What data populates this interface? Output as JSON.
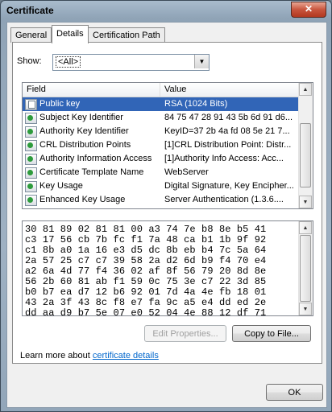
{
  "window": {
    "title": "Certificate",
    "close_glyph": "✕"
  },
  "tabs": [
    "General",
    "Details",
    "Certification Path"
  ],
  "active_tab": "Details",
  "show": {
    "label": "Show:",
    "value": "<All>"
  },
  "fields": {
    "headers": {
      "field": "Field",
      "value": "Value"
    },
    "rows": [
      {
        "field": "Public key",
        "value": "RSA (1024 Bits)",
        "icon": "certificate-field-icon",
        "selected": true
      },
      {
        "field": "Subject Key Identifier",
        "value": "84 75 47 28 91 43 5b 6d 91 d6...",
        "icon": "extension-icon"
      },
      {
        "field": "Authority Key Identifier",
        "value": "KeyID=37 2b 4a fd 08 5e 21 7...",
        "icon": "extension-icon"
      },
      {
        "field": "CRL Distribution Points",
        "value": "[1]CRL Distribution Point: Distr...",
        "icon": "extension-icon"
      },
      {
        "field": "Authority Information Access",
        "value": "[1]Authority Info Access: Acc...",
        "icon": "extension-icon"
      },
      {
        "field": "Certificate Template Name",
        "value": "WebServer",
        "icon": "extension-icon"
      },
      {
        "field": "Key Usage",
        "value": "Digital Signature, Key Encipher...",
        "icon": "extension-icon"
      },
      {
        "field": "Enhanced Key Usage",
        "value": "Server Authentication (1.3.6....",
        "icon": "extension-icon"
      }
    ]
  },
  "hex_lines": [
    "30 81 89 02 81 81 00 a3 74 7e b8 8e b5 41",
    "c3 17 56 cb 7b fc f1 7a 48 ca b1 1b 9f 92",
    "c1 8b a0 1a 16 e3 d5 dc 8b eb b4 7c 5a 64",
    "2a 57 25 c7 c7 39 58 2a d2 6d b9 f4 70 e4",
    "a2 6a 4d 77 f4 36 02 af 8f 56 79 20 8d 8e",
    "56 2b 60 81 ab f1 59 0c 75 3e c7 22 3d 85",
    "b0 b7 ea d7 12 b6 92 01 7d 4a 4e fb 18 01",
    "43 2a 3f 43 8c f8 e7 fa 9c a5 e4 dd ed 2e",
    "dd aa d9 b7 5e 07 e0 52 04 4e 88 12 df 71"
  ],
  "buttons": {
    "edit_properties": "Edit Properties...",
    "copy_to_file": "Copy to File...",
    "ok": "OK"
  },
  "learn_more": {
    "prefix": "Learn more about ",
    "link": "certificate details"
  }
}
